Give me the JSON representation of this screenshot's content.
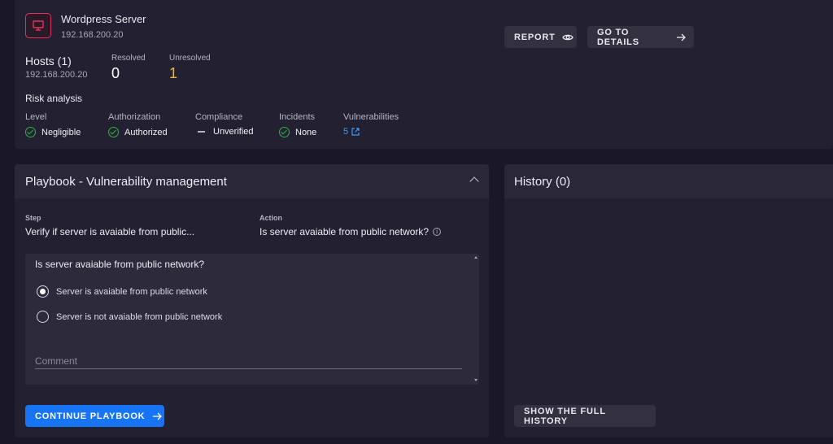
{
  "server": {
    "name": "Wordpress Server",
    "ip": "192.168.200.20",
    "icon": "monitor-icon",
    "accent": "#e0345e"
  },
  "actions": {
    "report_label": "REPORT",
    "details_label": "GO TO DETAILS"
  },
  "hosts": {
    "title": "Hosts (1)",
    "ip": "192.168.200.20",
    "resolved_label": "Resolved",
    "resolved_value": "0",
    "unresolved_label": "Unresolved",
    "unresolved_value": "1"
  },
  "risk": {
    "title": "Risk analysis",
    "level_label": "Level",
    "level_value": "Negligible",
    "authorization_label": "Authorization",
    "authorization_value": "Authorized",
    "compliance_label": "Compliance",
    "compliance_value": "Unverified",
    "incidents_label": "Incidents",
    "incidents_value": "None",
    "vulnerabilities_label": "Vulnerabilities",
    "vulnerabilities_value": "5"
  },
  "playbook": {
    "title": "Playbook - Vulnerability management",
    "step_label": "Step",
    "step_value": "Verify if server is avaiable from public...",
    "action_label": "Action",
    "action_value": "Is server avaiable from public network?",
    "question": "Is server avaiable from public network?",
    "options": [
      {
        "label": "Server is avaiable from public network",
        "selected": true
      },
      {
        "label": "Server is not avaiable from public network",
        "selected": false
      }
    ],
    "comment_placeholder": "Comment",
    "continue_label": "CONTINUE PLAYBOOK"
  },
  "history": {
    "title": "History (0)",
    "full_history_label": "SHOW THE FULL HISTORY"
  },
  "colors": {
    "background": "#1a1826",
    "card": "#232131",
    "primary": "#1774f5",
    "success": "#2fb344",
    "warning": "#f0b429",
    "link": "#3d9bff"
  }
}
